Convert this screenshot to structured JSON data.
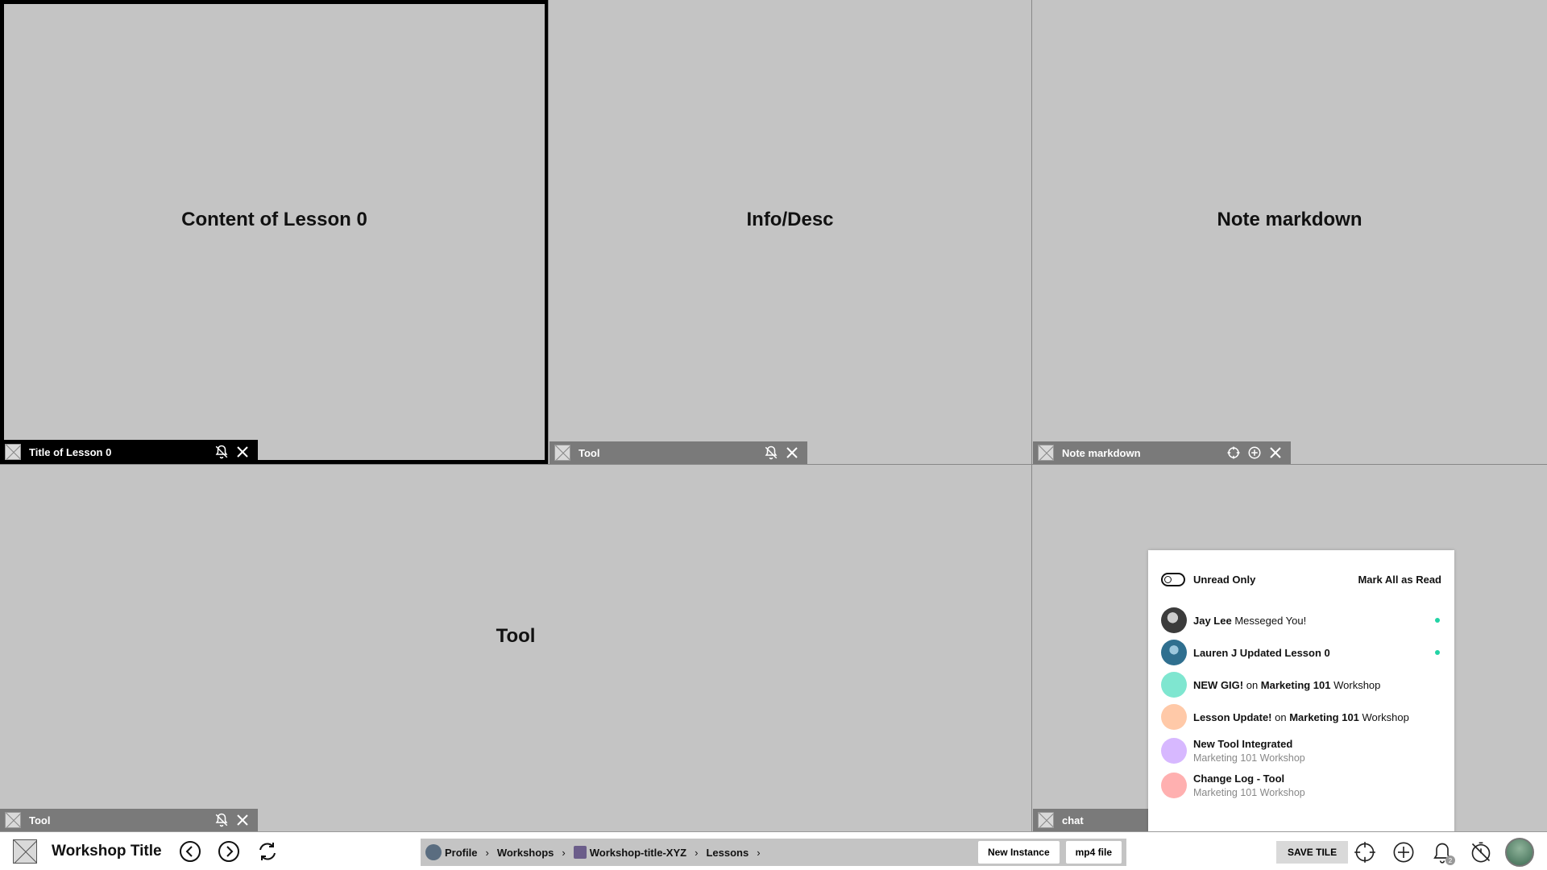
{
  "tiles": {
    "lesson": {
      "content": "Content of Lesson 0",
      "bar_title": "Title of Lesson 0"
    },
    "info": {
      "content": "Info/Desc",
      "bar_title": "Tool"
    },
    "note": {
      "content": "Note markdown",
      "bar_title": "Note markdown"
    },
    "tool": {
      "content": "Tool",
      "bar_title": "Tool"
    },
    "chat": {
      "content": "",
      "bar_title": "chat"
    }
  },
  "bottombar": {
    "title": "Workshop Title",
    "breadcrumb": [
      "Profile",
      "Workshops",
      "Workshop-title-XYZ",
      "Lessons"
    ],
    "new_instance": "New Instance",
    "mp4_file": "mp4 file",
    "save_tile": "SAVE TILE",
    "notification_count": "2"
  },
  "notifications": {
    "unread_only_label": "Unread Only",
    "mark_all_label": "Mark All as Read",
    "items": [
      {
        "actor": "Jay Lee",
        "text": " Messeged You!",
        "color": "#3b3b3b",
        "unread": true
      },
      {
        "actor": "Lauren J",
        "text": " Updated Lesson 0",
        "color": "#2f6f8f",
        "unread": true
      },
      {
        "actor": "NEW GIG!",
        "mid": " on ",
        "target": "Marketing 101",
        "tail": " Workshop",
        "color": "#7fe6d0"
      },
      {
        "actor": "Lesson Update!",
        "mid": " on ",
        "target": "Marketing 101",
        "tail": " Workshop",
        "color": "#ffc9a8"
      },
      {
        "actor": "New Tool Integrated",
        "sub": "Marketing 101 Workshop",
        "color": "#d7b8ff"
      },
      {
        "actor": "Change Log - Tool",
        "sub": "Marketing 101 Workshop",
        "color": "#ffb0b0"
      }
    ]
  },
  "colors": {
    "unread_dot": "#22d3a5",
    "tile_bg": "#c4c4c4",
    "bar_bg": "#7a7a7a",
    "active_bar_bg": "#000000"
  }
}
